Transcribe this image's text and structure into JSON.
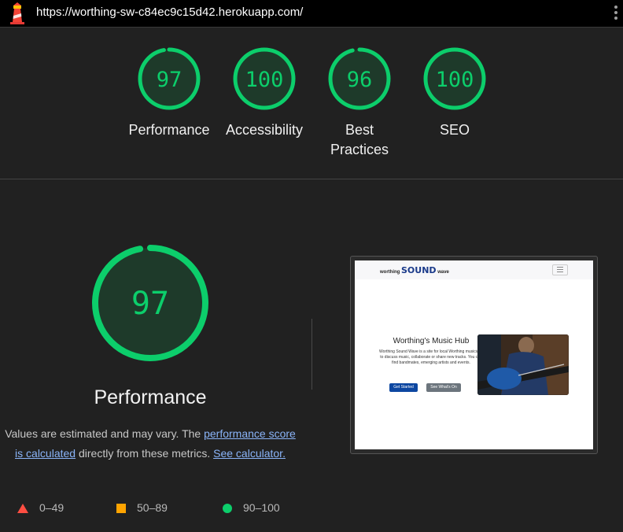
{
  "url": "https://worthing-sw-c84ec9c15d42.herokuapp.com/",
  "colors": {
    "pass": "#0cce6b",
    "pass_fill": "#1e3a2a",
    "average": "#ffa400",
    "fail": "#ff4e42",
    "link": "#8ab4f8"
  },
  "categories": [
    {
      "id": "performance",
      "label": "Performance",
      "score": 97
    },
    {
      "id": "accessibility",
      "label": "Accessibility",
      "score": 100
    },
    {
      "id": "best-practices",
      "label": "Best Practices",
      "score": 96
    },
    {
      "id": "seo",
      "label": "SEO",
      "score": 100
    }
  ],
  "performance": {
    "score": 97,
    "title": "Performance",
    "desc_prefix": "Values are estimated and may vary. The ",
    "desc_link": "performance score is calculated",
    "desc_middle": " directly from these metrics. ",
    "desc_link2": "See calculator."
  },
  "legend": [
    {
      "icon": "triangle-icon",
      "range": "0–49"
    },
    {
      "icon": "square-icon",
      "range": "50–89"
    },
    {
      "icon": "circle-icon",
      "range": "90–100"
    }
  ],
  "thumbnail": {
    "brand_small_1": "worthing",
    "brand_big": "SOUND",
    "brand_small_2": "wave",
    "heading": "Worthing's Music Hub",
    "text": "Worthing Sound Wave is a site for local Worthing musicians to discuss music, collaborate or share new tracks. You can find bandmates, emerging artists and events.",
    "btn_primary": "Get Started",
    "btn_secondary": "See What's On"
  }
}
